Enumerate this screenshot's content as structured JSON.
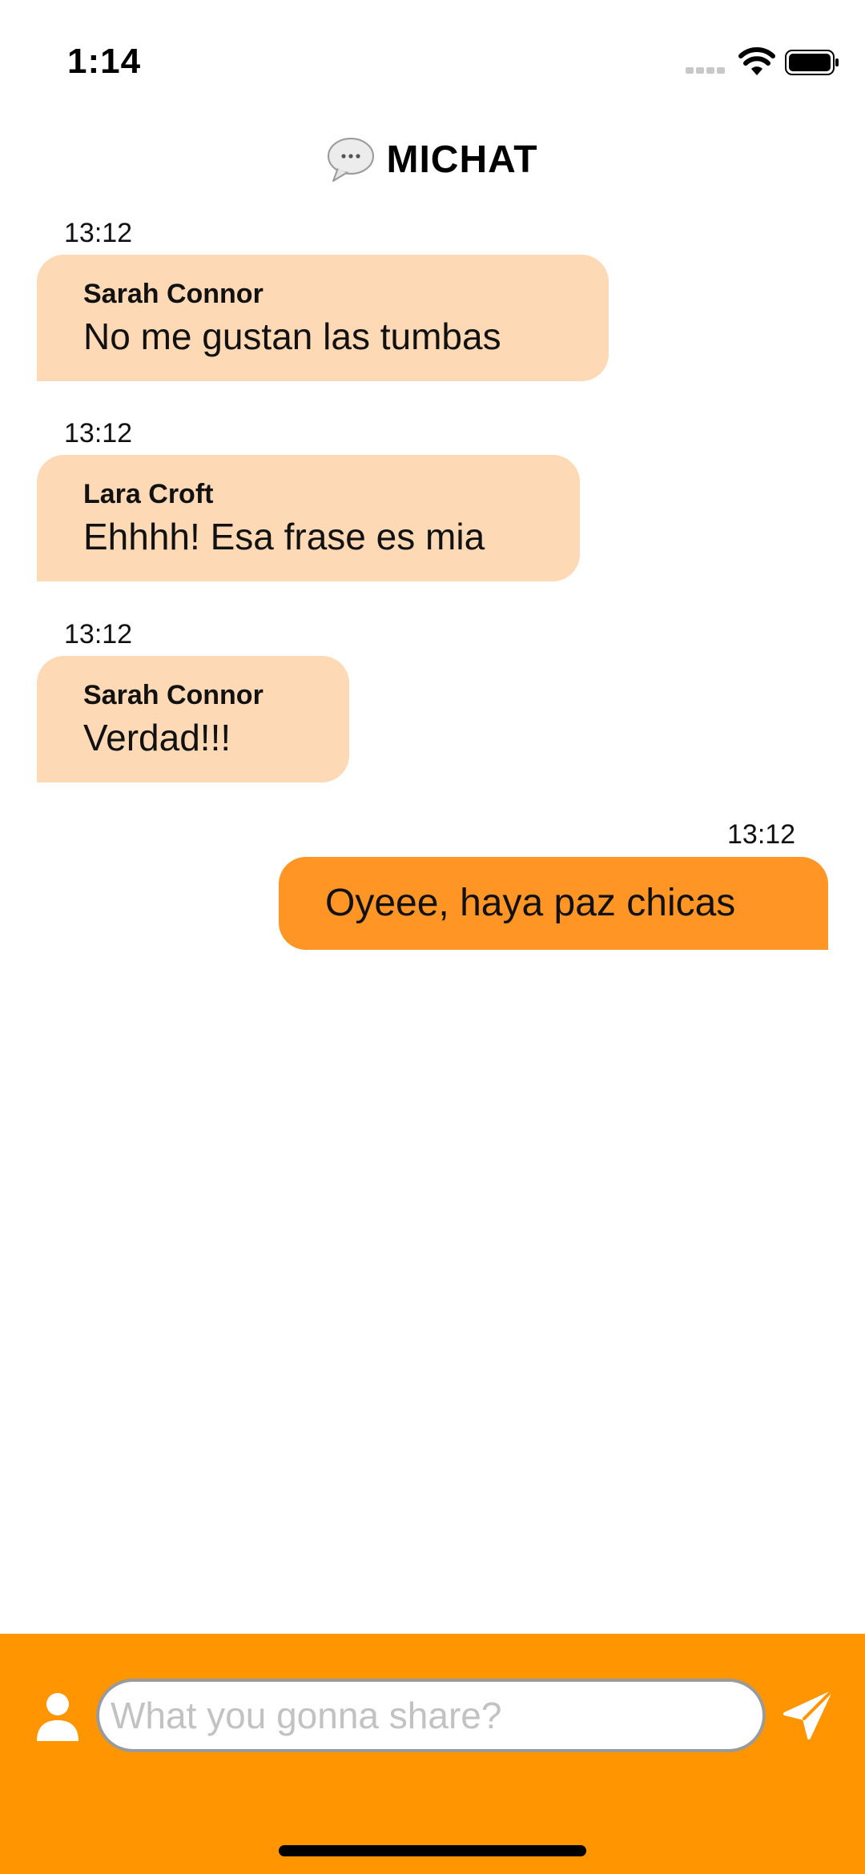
{
  "status_bar": {
    "time": "1:14"
  },
  "header": {
    "title": "MICHAT",
    "icon": "speech-bubble-icon"
  },
  "messages": [
    {
      "time": "13:12",
      "sender": "Sarah Connor",
      "text": "No me gustan las tumbas",
      "direction": "incoming"
    },
    {
      "time": "13:12",
      "sender": "Lara Croft",
      "text": "Ehhhh! Esa frase es mia",
      "direction": "incoming"
    },
    {
      "time": "13:12",
      "sender": "Sarah Connor",
      "text": "Verdad!!!",
      "direction": "incoming"
    },
    {
      "time": "13:12",
      "text": "Oyeee, haya paz chicas",
      "direction": "outgoing"
    }
  ],
  "composer": {
    "placeholder": "What you gonna share?",
    "value": "",
    "user_icon": "user-icon",
    "send_icon": "send-icon"
  },
  "colors": {
    "accent": "#FF9500",
    "incoming_bubble": "#FDD9B5",
    "outgoing_bubble": "#FF9524"
  }
}
